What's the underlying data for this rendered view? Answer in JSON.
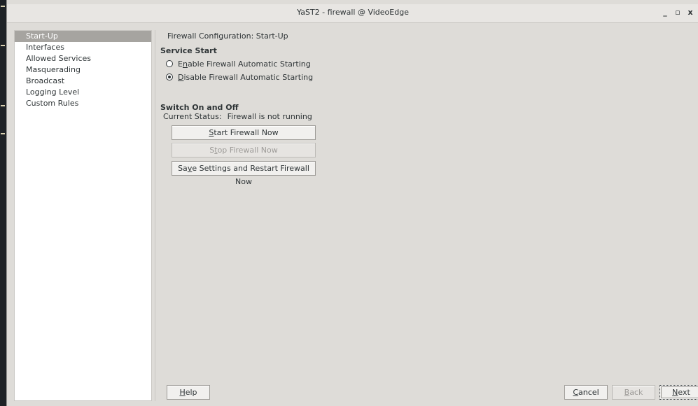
{
  "window": {
    "title": "YaST2 - firewall @ VideoEdge",
    "minimize_glyph": "_",
    "maximize_glyph": "▫",
    "close_glyph": "x"
  },
  "sidebar": {
    "items": [
      {
        "label": "Start-Up",
        "selected": true
      },
      {
        "label": "Interfaces"
      },
      {
        "label": "Allowed Services"
      },
      {
        "label": "Masquerading"
      },
      {
        "label": "Broadcast"
      },
      {
        "label": "Logging Level"
      },
      {
        "label": "Custom Rules"
      }
    ]
  },
  "main": {
    "heading": "Firewall Configuration: Start-Up",
    "service_start": {
      "title": "Service Start",
      "options": [
        {
          "pre": "E",
          "mnemonic": "n",
          "post": "able Firewall Automatic Starting",
          "checked": false
        },
        {
          "pre": "",
          "mnemonic": "D",
          "post": "isable Firewall Automatic Starting",
          "checked": true
        }
      ]
    },
    "switch": {
      "title": "Switch On and Off",
      "status_label": "Current Status:",
      "status_value": "Firewall is not running",
      "start_button": {
        "pre": "",
        "mnemonic": "S",
        "post": "tart Firewall Now"
      },
      "stop_button": {
        "pre": "S",
        "mnemonic": "t",
        "post": "op Firewall Now"
      },
      "save_button": {
        "pre": "Sa",
        "mnemonic": "v",
        "post": "e Settings and Restart Firewall Now"
      }
    }
  },
  "footer": {
    "help": {
      "pre": "",
      "mnemonic": "H",
      "post": "elp"
    },
    "cancel": {
      "pre": "",
      "mnemonic": "C",
      "post": "ancel"
    },
    "back": {
      "pre": "",
      "mnemonic": "B",
      "post": "ack"
    },
    "next": {
      "pre": "",
      "mnemonic": "N",
      "post": "ext"
    }
  }
}
